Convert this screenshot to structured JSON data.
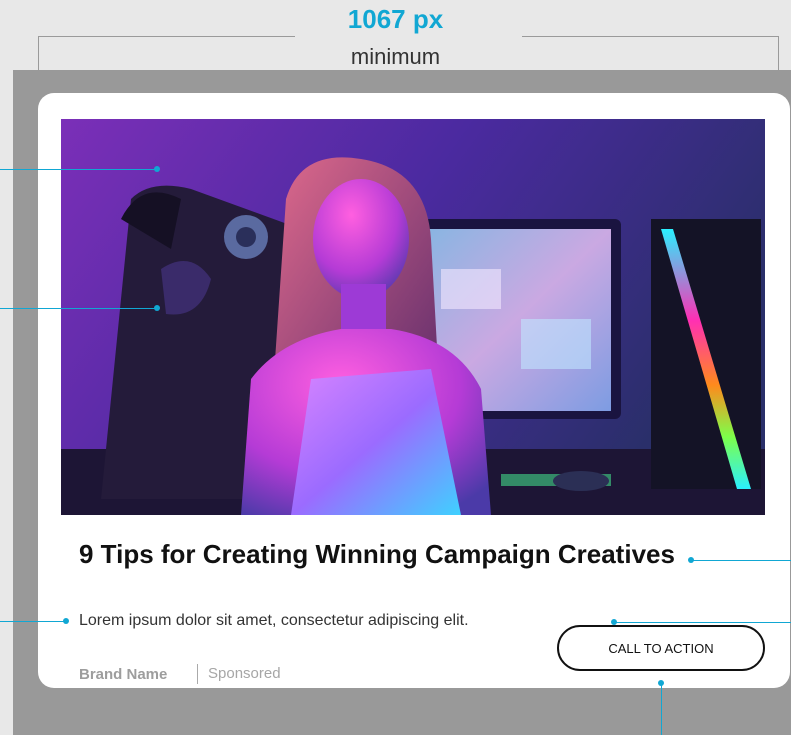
{
  "dimension": {
    "width_label": "1067 px",
    "min_label": "minimum"
  },
  "ad": {
    "headline": "9 Tips for Creating Winning Campaign Creatives",
    "description": "Lorem ipsum dolor sit amet, consectetur adipiscing elit.",
    "brand_name": "Brand Name",
    "sponsored_label": "Sponsored",
    "cta_label": "CALL TO ACTION"
  },
  "colors": {
    "accent": "#11a7d3",
    "card_background": "#ffffff",
    "frame_background": "#999999"
  }
}
